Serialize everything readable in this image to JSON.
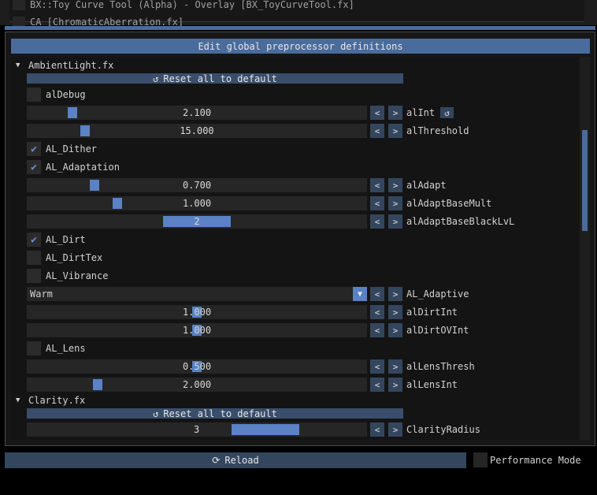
{
  "top_list": [
    {
      "label": "BX::Toy Curve Tool (Alpha) - Overlay [BX_ToyCurveTool.fx]"
    },
    {
      "label": "CA [ChromaticAberration.fx]"
    }
  ],
  "header": {
    "title": "Edit global preprocessor definitions"
  },
  "reset_label": "Reset all to default",
  "ambient": {
    "file": "AmbientLight.fx",
    "alDebug": "alDebug",
    "alInt": {
      "value": "2.100",
      "fraction": 0.123,
      "name": "alInt"
    },
    "alThreshold": {
      "value": "15.000",
      "fraction": 0.163,
      "name": "alThreshold"
    },
    "AL_Dither": "AL_Dither",
    "AL_Adaptation": "AL_Adaptation",
    "alAdapt": {
      "value": "0.700",
      "fraction": 0.19,
      "name": "alAdapt"
    },
    "alAdaptBaseMult": {
      "value": "1.000",
      "fraction": 0.26,
      "name": "alAdaptBaseMult"
    },
    "alAdaptBaseBlackLvL": {
      "value": "2",
      "fraction": 0.5,
      "name": "alAdaptBaseBlackLvL"
    },
    "AL_Dirt": "AL_Dirt",
    "AL_DirtTex": "AL_DirtTex",
    "AL_Vibrance": "AL_Vibrance",
    "AL_Adaptive": {
      "selected": "Warm",
      "name": "AL_Adaptive"
    },
    "alDirtInt": {
      "value": "1.000",
      "fraction": 0.5,
      "name": "alDirtInt"
    },
    "alDirtOVInt": {
      "value": "1.000",
      "fraction": 0.5,
      "name": "alDirtOVInt"
    },
    "AL_Lens": "AL_Lens",
    "alLensThresh": {
      "value": "0.500",
      "fraction": 0.5,
      "name": "alLensThresh"
    },
    "alLensInt": {
      "value": "2.000",
      "fraction": 0.2,
      "name": "alLensInt"
    }
  },
  "clarity": {
    "file": "Clarity.fx",
    "ClarityRadius": {
      "value": "3",
      "fraction": 0.75,
      "name": "ClarityRadius"
    }
  },
  "arrows": {
    "left": "<",
    "right": ">"
  },
  "icons": {
    "reset": "↺",
    "reload": "⟳",
    "dropdown": "▼",
    "check": "✔",
    "tree_open": "▼"
  },
  "bottom": {
    "reload_label": "Reload",
    "perf_label": "Performance Mode"
  }
}
